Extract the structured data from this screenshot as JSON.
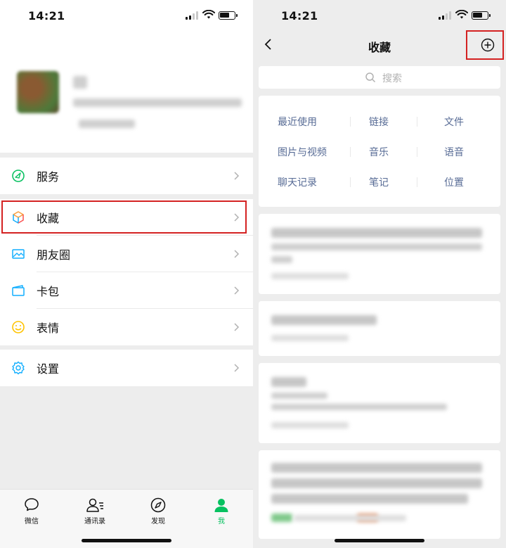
{
  "left": {
    "status_time": "14:21",
    "menu": [
      {
        "label": "服务"
      },
      {
        "label": "收藏"
      },
      {
        "label": "朋友圈"
      },
      {
        "label": "卡包"
      },
      {
        "label": "表情"
      },
      {
        "label": "设置"
      }
    ],
    "tabs": [
      {
        "label": "微信"
      },
      {
        "label": "通讯录"
      },
      {
        "label": "发现"
      },
      {
        "label": "我"
      }
    ],
    "colors": {
      "accent": "#07c160",
      "highlight": "#d42222"
    }
  },
  "right": {
    "status_time": "14:21",
    "title": "收藏",
    "search_placeholder": "搜索",
    "categories": [
      "最近使用",
      "链接",
      "文件",
      "图片与视频",
      "音乐",
      "语音",
      "聊天记录",
      "笔记",
      "位置"
    ],
    "colors": {
      "link": "#576b95"
    }
  }
}
